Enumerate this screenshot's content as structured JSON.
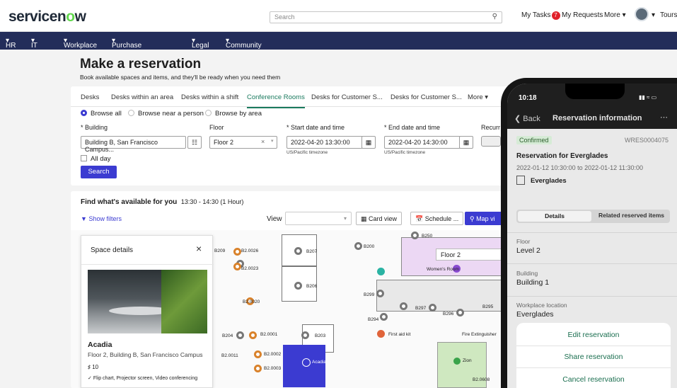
{
  "header": {
    "logo": "servicenow",
    "search_placeholder": "Search",
    "my_tasks": "My Tasks",
    "tasks_count": "7",
    "my_requests": "My Requests",
    "more": "More",
    "tours": "Tours"
  },
  "navbar": [
    "HR",
    "IT",
    "Workplace",
    "Purchase and Expense",
    "Legal",
    "Community"
  ],
  "page": {
    "title": "Make a reservation",
    "subtitle": "Book available spaces and items, and they'll be ready when you need them",
    "tabs": [
      "Desks",
      "Desks within an area",
      "Desks within a shift",
      "Conference Rooms",
      "Desks for Customer S...",
      "Desks for Customer S...",
      "More"
    ],
    "active_tab": "Conference Rooms",
    "radios": [
      "Browse all",
      "Browse near a person",
      "Browse by area"
    ],
    "building_label": "* Building",
    "building_value": "Building B, San Francisco Campus...",
    "floor_label": "Floor",
    "floor_value": "Floor 2",
    "start_label": "* Start date and time",
    "start_value": "2022-04-20 13:30:00",
    "end_label": "* End date and time",
    "end_value": "2022-04-20 14:30:00",
    "timezone": "US/Pacific timezone",
    "recurring_label": "Recurr",
    "all_day": "All day",
    "search_button": "Search"
  },
  "results": {
    "title": "Find what's available for you",
    "time": "13:30 - 14:30 (1 Hour)",
    "show_filters": "Show filters",
    "view_label": "View",
    "card_view": "Card view",
    "schedule": "Schedule ...",
    "map_view": "Map vi",
    "map_floor": "Floor 2",
    "map_labels": [
      "B209",
      "B2.0026",
      "B2.0023",
      "B207",
      "B206",
      "B200",
      "B250",
      "Women's Room",
      "B299",
      "B297",
      "B296",
      "B295",
      "B294",
      "First aid kit",
      "Fire Extinguisher",
      "B2.0020",
      "B204",
      "B2.0001",
      "B203",
      "B2.0011",
      "B2.0002",
      "B2.0003",
      "Acadia",
      "Zion",
      "B2.0608"
    ]
  },
  "space_details": {
    "header": "Space details",
    "name": "Acadia",
    "address": "Floor 2, Building B, San Francisco Campus",
    "capacity": "10",
    "amenities": "Flip chart, Projector screen, Video conferencing"
  },
  "phone": {
    "time": "10:18",
    "back": "Back",
    "title": "Reservation information",
    "status": "Confirmed",
    "number": "WRES0004075",
    "res_title": "Reservation for Everglades",
    "res_dates": "2022-01-12 10:30:00 to 2022-01-12 11:30:00",
    "res_location": "Everglades",
    "tab_details": "Details",
    "tab_related": "Related reserved items",
    "floor_label": "Floor",
    "floor_value": "Level 2",
    "building_label": "Building",
    "building_value": "Building 1",
    "workplace_label": "Workplace location",
    "workplace_value": "Everglades",
    "edit": "Edit reservation",
    "share": "Share reservation",
    "cancel": "Cancel reservation"
  }
}
